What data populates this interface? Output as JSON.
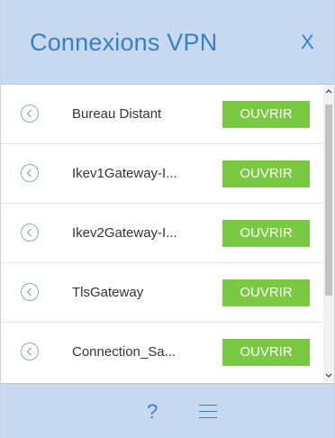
{
  "header": {
    "title": "Connexions VPN",
    "close_label": "X"
  },
  "connections": [
    {
      "name": "Bureau Distant",
      "action_label": "OUVRIR"
    },
    {
      "name": "Ikev1Gateway-I...",
      "action_label": "OUVRIR"
    },
    {
      "name": "Ikev2Gateway-I...",
      "action_label": "OUVRIR"
    },
    {
      "name": "TlsGateway",
      "action_label": "OUVRIR"
    },
    {
      "name": "Connection_Sa...",
      "action_label": "OUVRIR"
    }
  ],
  "footer": {
    "help_label": "?",
    "menu_icon": "hamburger-menu-icon"
  },
  "colors": {
    "header_bg": "#c6d9f1",
    "accent": "#3a7fc1",
    "button_green": "#7ac943"
  }
}
